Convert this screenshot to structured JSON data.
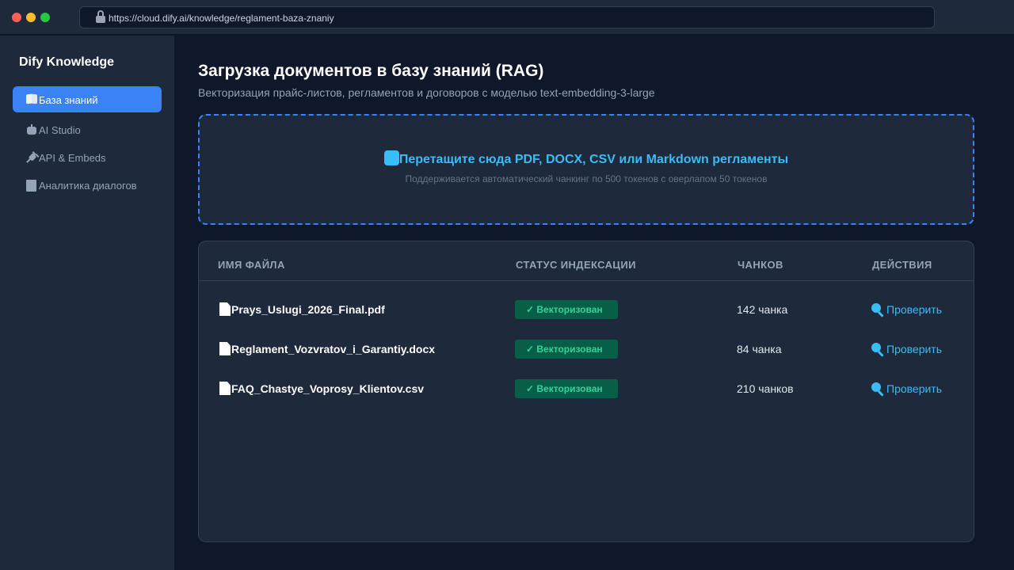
{
  "browser": {
    "url": "https://cloud.dify.ai/knowledge/reglament-baza-znaniy"
  },
  "sidebar": {
    "brand": "Dify Knowledge",
    "items": [
      {
        "label": "База знаний",
        "icon": "book-icon",
        "active": true
      },
      {
        "label": "AI Studio",
        "icon": "robot-icon",
        "active": false
      },
      {
        "label": "API & Embeds",
        "icon": "plug-icon",
        "active": false
      },
      {
        "label": "Аналитика диалогов",
        "icon": "document-icon",
        "active": false
      }
    ]
  },
  "main": {
    "title": "Загрузка документов в базу знаний (RAG)",
    "subtitle": "Векторизация прайс-листов, регламентов и договоров с моделью text-embedding-3-large"
  },
  "dropzone": {
    "icon": "upload-icon",
    "label": "Перетащите сюда PDF, DOCX, CSV или Markdown регламенты",
    "hint": "Поддерживается автоматический чанкинг по 500 токенов с оверлапом 50 токенов"
  },
  "table": {
    "headers": [
      "ИМЯ ФАЙЛА",
      "СТАТУС ИНДЕКСАЦИИ",
      "ЧАНКОВ",
      "ДЕЙСТВИЯ"
    ],
    "rows": [
      {
        "file": "Prays_Uslugi_2026_Final.pdf",
        "status": "✓ Векторизован",
        "chunks": "142 чанка",
        "action": "Проверить"
      },
      {
        "file": "Reglament_Vozvratov_i_Garantiy.docx",
        "status": "✓ Векторизован",
        "chunks": "84 чанка",
        "action": "Проверить"
      },
      {
        "file": "FAQ_Chastye_Voprosy_Klientov.csv",
        "status": "✓ Векторизован",
        "chunks": "210 чанков",
        "action": "Проверить"
      }
    ]
  },
  "colors": {
    "accent": "#3b82f6",
    "link": "#38bdf8",
    "success_bg": "#065f46",
    "success_text": "#34d399",
    "background": "#0f172a",
    "panel": "#1e293b"
  }
}
